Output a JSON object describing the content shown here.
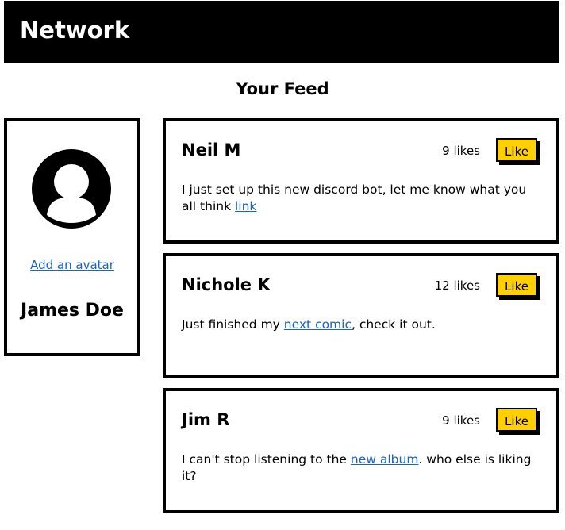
{
  "header": {
    "brand": "Network"
  },
  "feed": {
    "title": "Your Feed"
  },
  "profile": {
    "add_avatar_label": "Add an avatar",
    "name": "James Doe",
    "avatar_icon": "user-circle-icon"
  },
  "colors": {
    "accent": "#ffd000",
    "link": "#1a63c4",
    "header_bg": "#000000"
  },
  "posts": [
    {
      "author": "Neil M",
      "likes": "9 likes",
      "like_label": "Like",
      "text_before": "I just set up this new discord bot, let me know what you all think ",
      "link_text": "link",
      "text_after": ""
    },
    {
      "author": "Nichole K",
      "likes": "12 likes",
      "like_label": "Like",
      "text_before": "Just finished my ",
      "link_text": "next comic",
      "text_after": ", check it out."
    },
    {
      "author": "Jim R",
      "likes": "9 likes",
      "like_label": "Like",
      "text_before": "I can't stop listening to the ",
      "link_text": "new album",
      "text_after": ". who else is liking it?"
    }
  ]
}
